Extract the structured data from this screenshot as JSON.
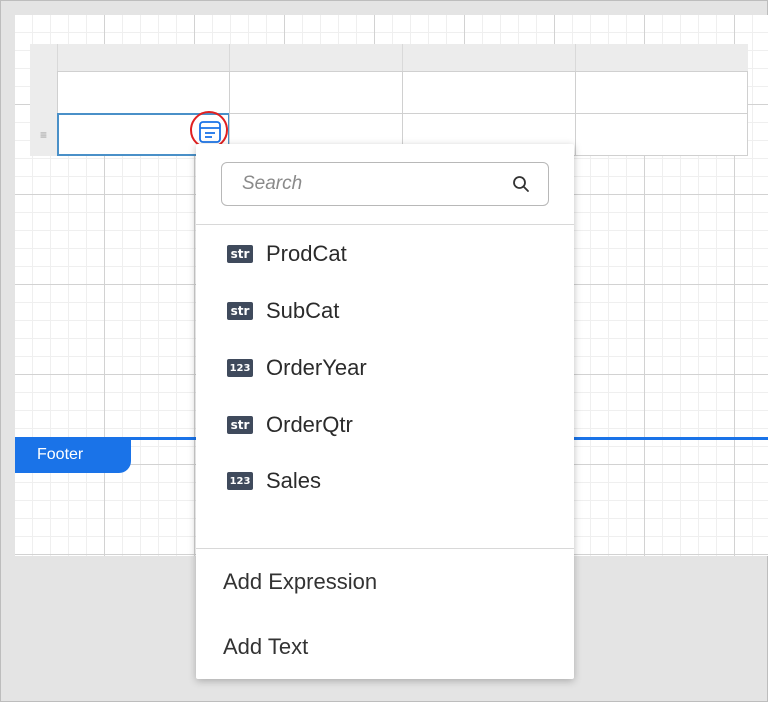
{
  "designer": {
    "footer_label": "Footer",
    "row_handle_symbol": "≡",
    "colors": {
      "accent": "#1a73e8",
      "selection_border": "#4a90c8",
      "highlight_circle": "#e02020",
      "badge_bg": "#3f4a5c"
    }
  },
  "dropdown": {
    "search": {
      "placeholder": "Search",
      "value": "",
      "icon": "search-icon"
    },
    "fields": [
      {
        "type": "str",
        "name": "ProdCat"
      },
      {
        "type": "str",
        "name": "SubCat"
      },
      {
        "type": "123",
        "name": "OrderYear"
      },
      {
        "type": "str",
        "name": "OrderQtr"
      },
      {
        "type": "123",
        "name": "Sales"
      }
    ],
    "actions": [
      {
        "label": "Add Expression"
      },
      {
        "label": "Add Text"
      }
    ]
  }
}
